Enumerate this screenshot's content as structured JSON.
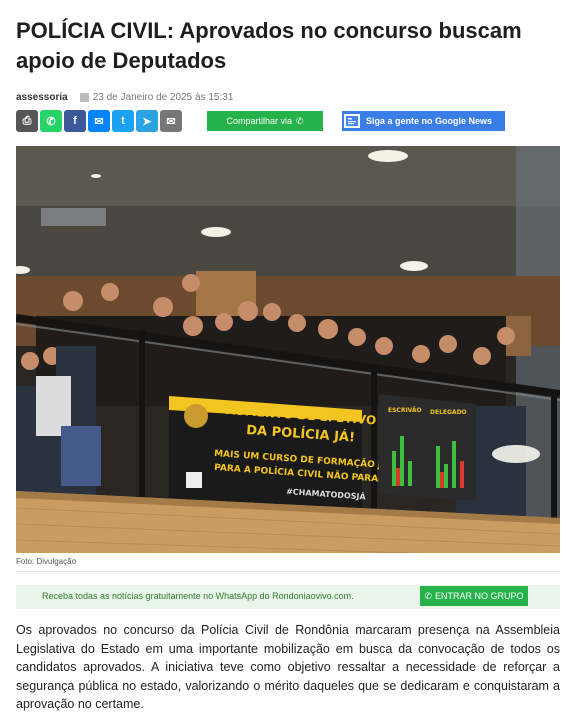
{
  "article": {
    "title": "POLÍCIA CIVIL: Aprovados no concurso buscam apoio de Deputados",
    "author": "assessoria",
    "date": "23 de Janeiro de 2025 às 15:31",
    "photo_caption": "Foto: Divulgação",
    "body": "Os aprovados no concurso da Polícia Civil de Rondônia marcaram presença na Assembleia Legislativa do Estado em uma importante mobilização em busca da convocação de todos os candidatos aprovados. A iniciativa teve como objetivo ressaltar a necessidade de reforçar a segurança pública no estado, valorizando o mérito daqueles que se dedicaram e conquistaram a aprovação no certame."
  },
  "share": {
    "icons": [
      {
        "name": "print-icon",
        "color": "#555555",
        "glyph": "⎙"
      },
      {
        "name": "whatsapp-icon",
        "color": "#25d366",
        "glyph": "✆"
      },
      {
        "name": "facebook-icon",
        "color": "#3b5998",
        "glyph": "f"
      },
      {
        "name": "messenger-icon",
        "color": "#0084ff",
        "glyph": "✉"
      },
      {
        "name": "twitter-icon",
        "color": "#1da1f2",
        "glyph": "t"
      },
      {
        "name": "telegram-icon",
        "color": "#2aa3e0",
        "glyph": "➤"
      },
      {
        "name": "email-icon",
        "color": "#777777",
        "glyph": "✉"
      }
    ],
    "share_via_label": "Compartilhar via",
    "google_news_label": "Siga a gente no Google News"
  },
  "whatsapp_banner": {
    "text": "Receba todas as notícias gratuitamente no WhatsApp do Rondoniaovivo.com.",
    "button_label": "ENTRAR NO GRUPO"
  },
  "photo": {
    "banner_main": [
      "AUMENTO DE EFETIVO",
      "DA POLÍCIA JÁ!",
      "MAIS UM CURSO DE FORMAÇÃO JÁ",
      "PARA A POLÍCIA CIVIL NÃO PARAR!",
      "#CHAMATODOSJÁ"
    ],
    "banner_side": [
      "ESCRIVÃO",
      "DELEGADO"
    ]
  },
  "colors": {
    "brand_green": "#25b24a",
    "google_blue": "#3b7de6"
  }
}
